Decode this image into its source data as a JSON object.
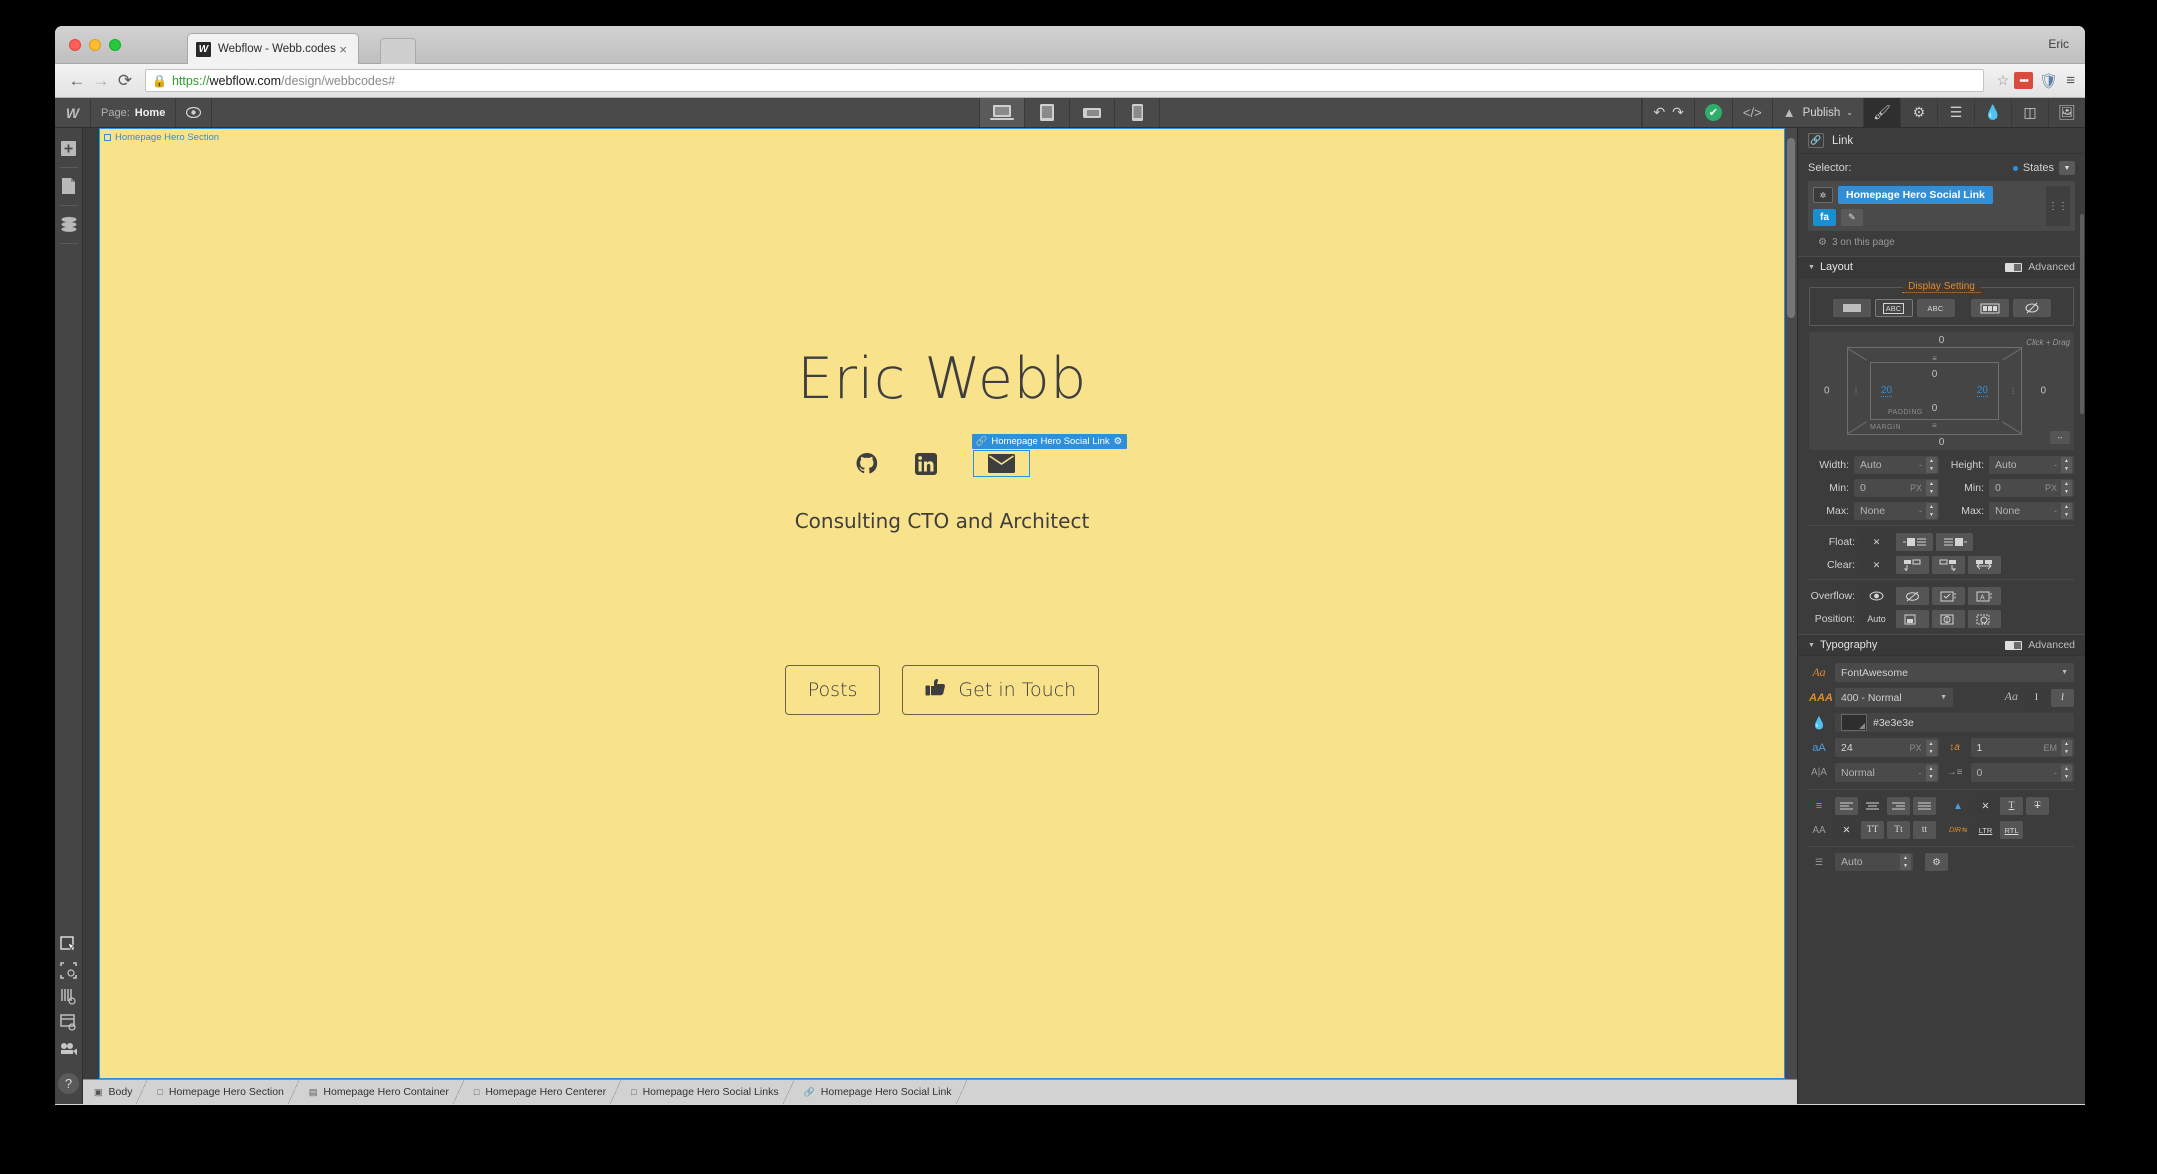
{
  "browser": {
    "tab": {
      "title": "Webflow - Webb.codes",
      "favicon_letter": "W",
      "close_icon": "×"
    },
    "profile": "Eric",
    "url": {
      "scheme": "https://",
      "host": "webflow.com",
      "path": "/design/webbcodes#"
    },
    "nav": {
      "back": "←",
      "forward": "→",
      "reload": "⟳",
      "star": "☆",
      "menu": "≡"
    }
  },
  "toolbar": {
    "logo": "W",
    "page_label": "Page:",
    "page_value": "Home",
    "preview_icon": "preview-eye-icon",
    "viewports": [
      "desktop",
      "tablet",
      "mobile-landscape",
      "mobile-portrait"
    ],
    "undo": "↶",
    "redo": "↷",
    "status_check": "✔",
    "code_icon": "</>",
    "publish_label": "Publish",
    "publish_caret": "⌄",
    "panel_tabs": [
      "style-brush",
      "settings-gear",
      "navigator",
      "interactions",
      "symbols",
      "assets"
    ]
  },
  "left_rail": {
    "top": [
      "add-panel",
      "pages-panel",
      "cms-panel"
    ],
    "bottom": [
      "select-tool",
      "guides-toggle",
      "grid-toggle",
      "layout-preview",
      "interactions-preview"
    ],
    "help": "?"
  },
  "canvas": {
    "section_badge": "Homepage Hero Section",
    "hero_name": "Eric Webb",
    "hero_subtitle": "Consulting CTO and Architect",
    "social": [
      {
        "name": "github-icon",
        "selected": false
      },
      {
        "name": "linkedin-icon",
        "selected": false
      },
      {
        "name": "email-envelope-icon",
        "selected": true
      }
    ],
    "selection_badge": {
      "label": "Homepage Hero Social Link",
      "gear": "⚙"
    },
    "buttons": [
      {
        "label": "Posts",
        "icon": null
      },
      {
        "label": "Get in Touch",
        "icon": "thumbs-up-icon"
      }
    ],
    "background_color": "#f8e28c",
    "text_color": "#3e3e3e",
    "selection_color": "#2f8fd8"
  },
  "breadcrumb": [
    "Body",
    "Homepage Hero Section",
    "Homepage Hero Container",
    "Homepage Hero Centerer",
    "Homepage Hero Social Links",
    "Homepage Hero Social Link"
  ],
  "right_panel": {
    "title": "Link",
    "selector": {
      "label": "Selector:",
      "states_label": "States",
      "class_tag": "Homepage Hero Social Link",
      "sub_tag": "fa",
      "count_text": "3 on this page"
    },
    "layout": {
      "title": "Layout",
      "advanced_label": "Advanced",
      "display_setting_label": "Display Setting",
      "display_options": [
        "block",
        "inline-block",
        "inline",
        "flex",
        "none"
      ],
      "display_selected_index": 1,
      "box_model": {
        "margin_top": "0",
        "margin_right": "0",
        "margin_bottom": "0",
        "margin_left": "0",
        "padding_top": "0",
        "padding_right": "20",
        "padding_bottom": "0",
        "padding_left": "20",
        "margin_label": "MARGIN",
        "padding_label": "PADDING",
        "hint": "Click + Drag"
      },
      "width": {
        "label": "Width:",
        "value": "Auto",
        "unit": "-"
      },
      "height": {
        "label": "Height:",
        "value": "Auto",
        "unit": "-"
      },
      "min_width": {
        "label": "Min:",
        "value": "0",
        "unit": "PX"
      },
      "min_height": {
        "label": "Min:",
        "value": "0",
        "unit": "PX"
      },
      "max_width": {
        "label": "Max:",
        "value": "None",
        "unit": "-"
      },
      "max_height": {
        "label": "Max:",
        "value": "None",
        "unit": "-"
      },
      "float": {
        "label": "Float:",
        "options": [
          "none",
          "left",
          "right"
        ],
        "selected": 0
      },
      "clear": {
        "label": "Clear:",
        "options": [
          "none",
          "left",
          "right",
          "both"
        ],
        "selected": 0
      },
      "overflow": {
        "label": "Overflow:",
        "options": [
          "visible",
          "hidden",
          "scroll",
          "auto"
        ],
        "selected": 0
      },
      "position": {
        "label": "Position:",
        "value": "Auto",
        "options": [
          "relative",
          "absolute",
          "fixed"
        ]
      }
    },
    "typography": {
      "title": "Typography",
      "advanced_label": "Advanced",
      "font_family": "FontAwesome",
      "font_weight": "400 - Normal",
      "color": "#3e3e3e",
      "font_size": "24",
      "font_size_unit": "PX",
      "line_height": "1",
      "line_height_unit": "EM",
      "letter_spacing": "Normal",
      "letter_spacing_unit": "-",
      "indent": "0",
      "indent_unit": "-",
      "align_options": [
        "left",
        "center",
        "right",
        "justify"
      ],
      "align_selected": 1,
      "decoration_options": [
        "none",
        "underline",
        "strikethrough"
      ],
      "decoration_selected": 0,
      "case_options": [
        "none",
        "TT",
        "Tt",
        "tt"
      ],
      "case_selected": 0,
      "direction_options": [
        "LTR",
        "RTL"
      ],
      "direction_selected": 0,
      "bottom_value": "Auto"
    }
  }
}
